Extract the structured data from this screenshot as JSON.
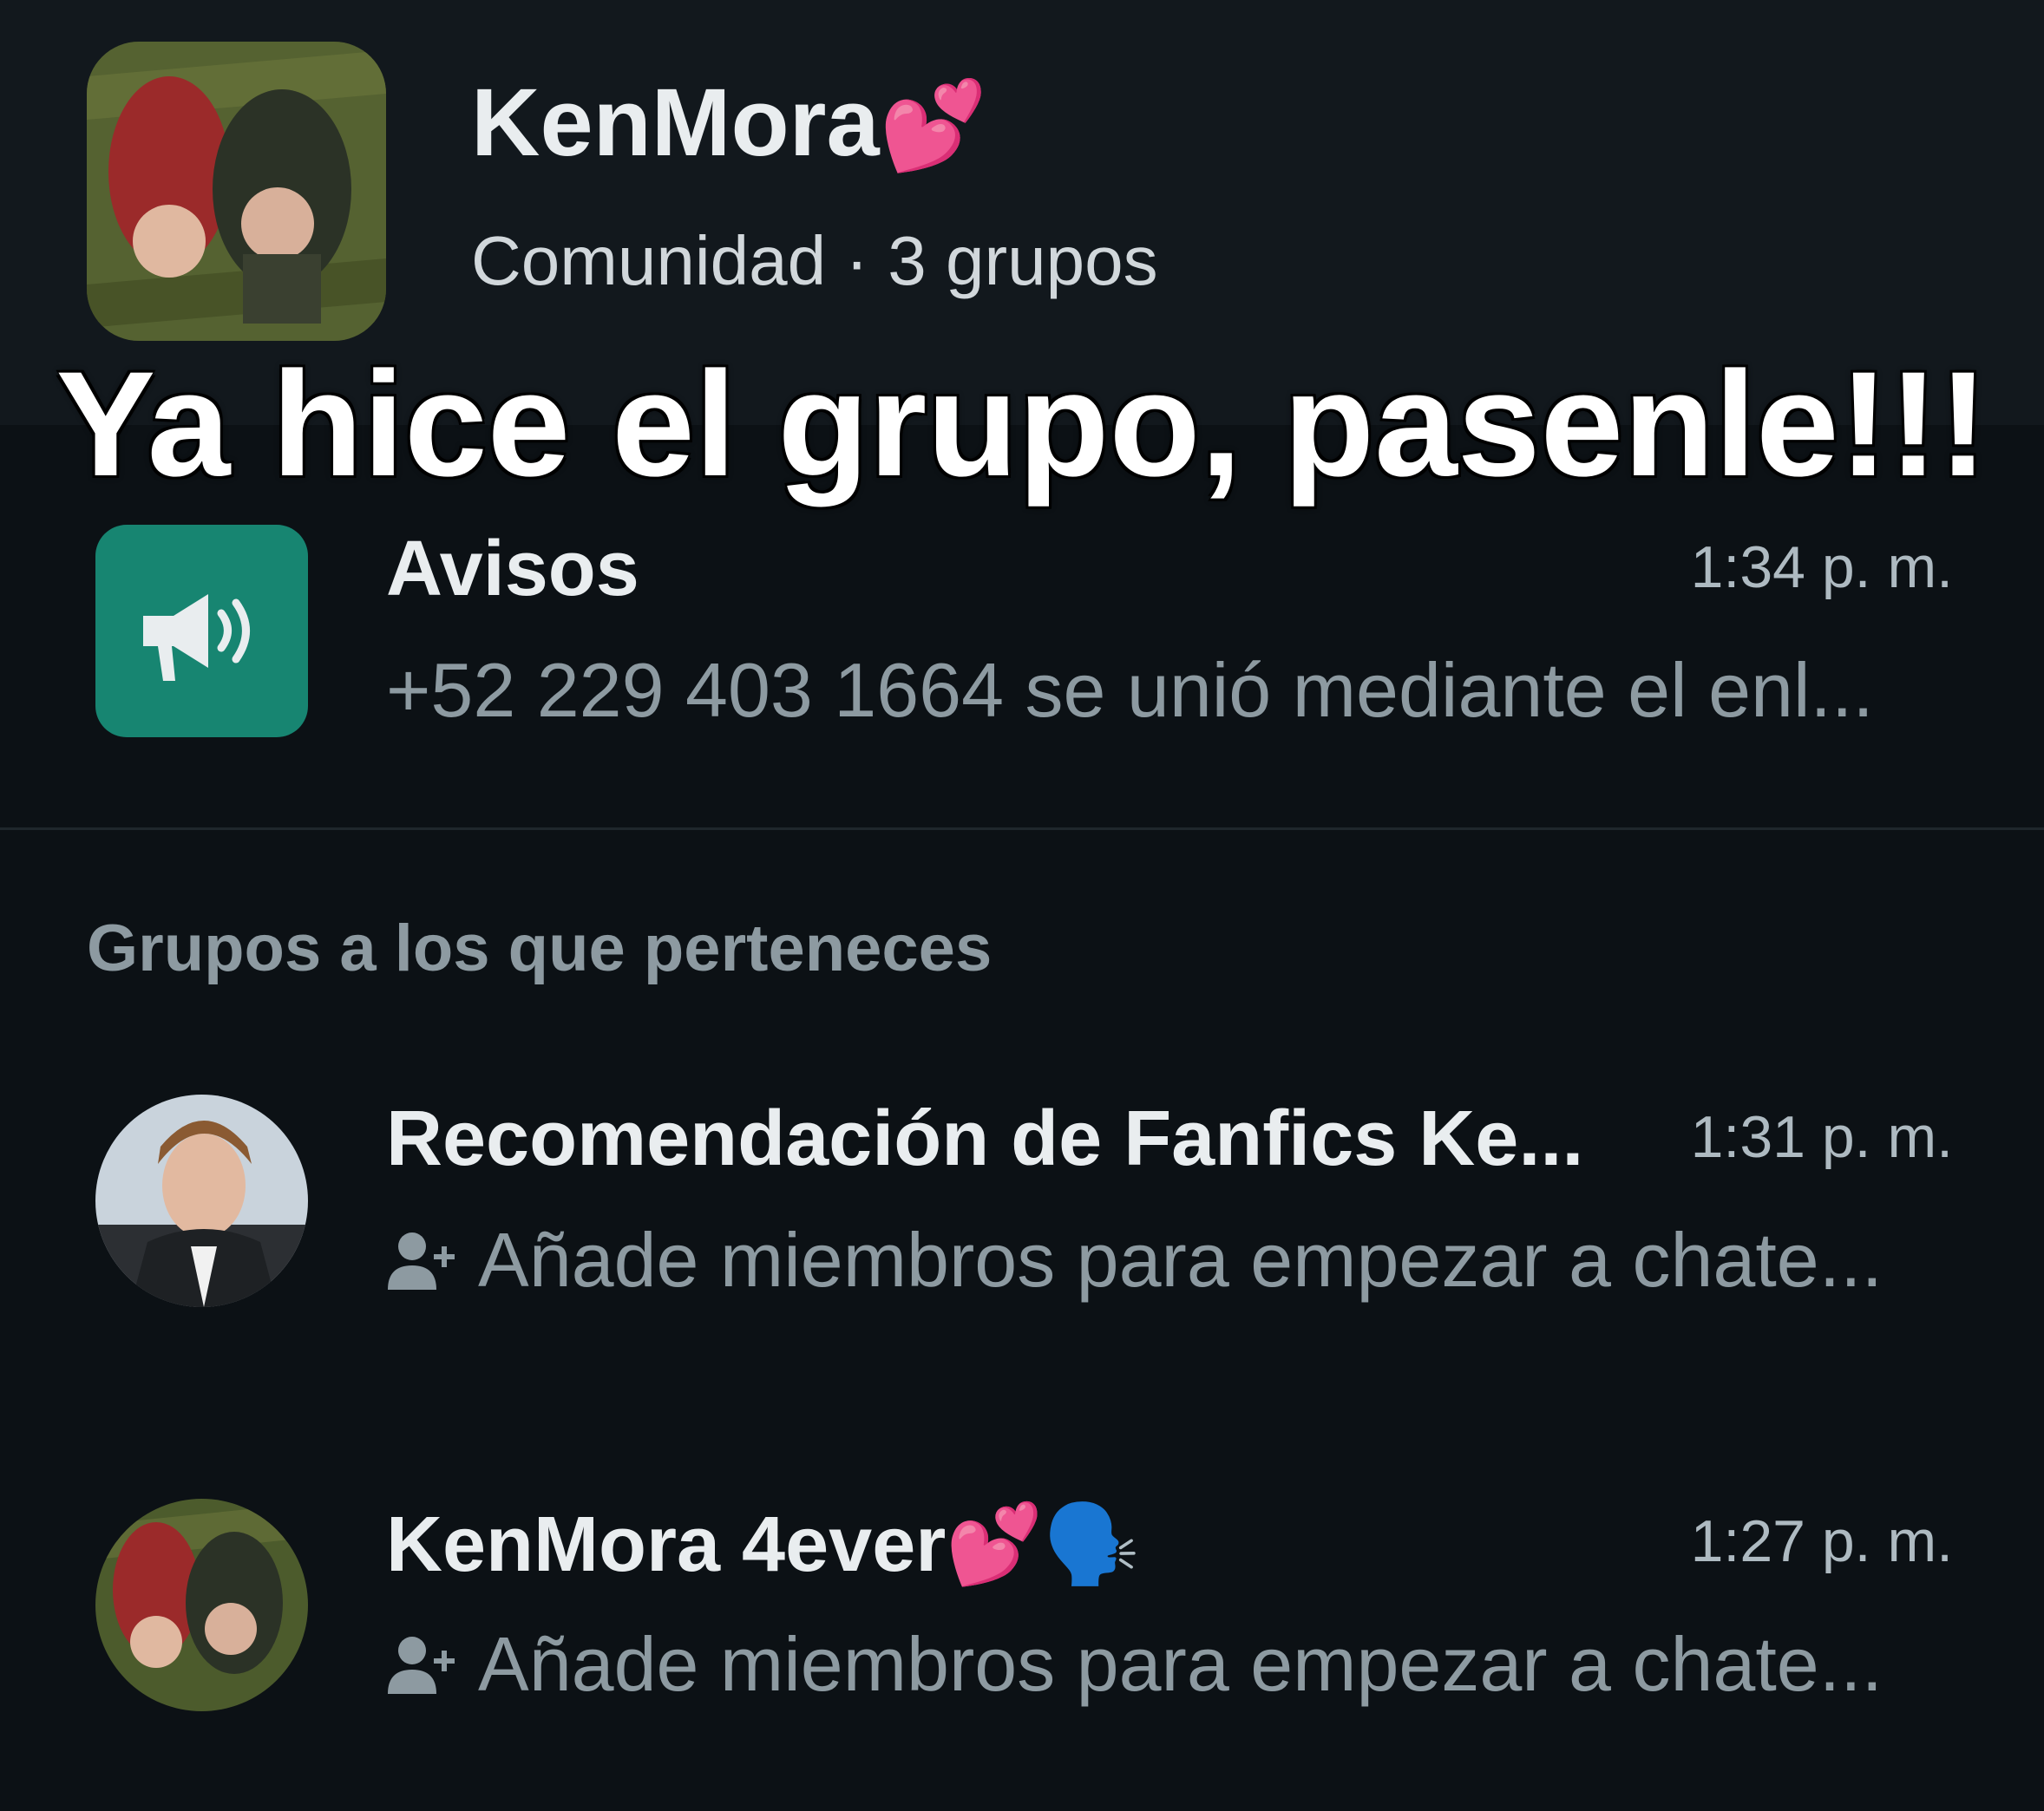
{
  "community": {
    "name": "KenMora",
    "name_emoji": "💕",
    "meta": "Comunidad · 3 grupos"
  },
  "overlay_caption": "Ya hice el grupo, pasenle!!!",
  "announcements": {
    "title": "Avisos",
    "time": "1:34 p. m.",
    "preview": "+52 229 403 1664 se unió mediante el enl...",
    "icon": "megaphone-icon",
    "accent_color": "#178571"
  },
  "groups_section": {
    "label": "Grupos a los que perteneces",
    "items": [
      {
        "title": "Recomendación de Fanfics Ke...",
        "time": "1:31 p. m.",
        "preview": "Añade miembros para empezar a chate..."
      },
      {
        "title": "KenMora 4ever",
        "title_emoji": "💕🗣️",
        "time": "1:27 p. m.",
        "preview": "Añade miembros para empezar a chate..."
      }
    ]
  },
  "colors": {
    "background": "#0c1115",
    "header_background": "#12181d",
    "primary_text": "#e9edef",
    "secondary_text": "#8d9aa1"
  }
}
